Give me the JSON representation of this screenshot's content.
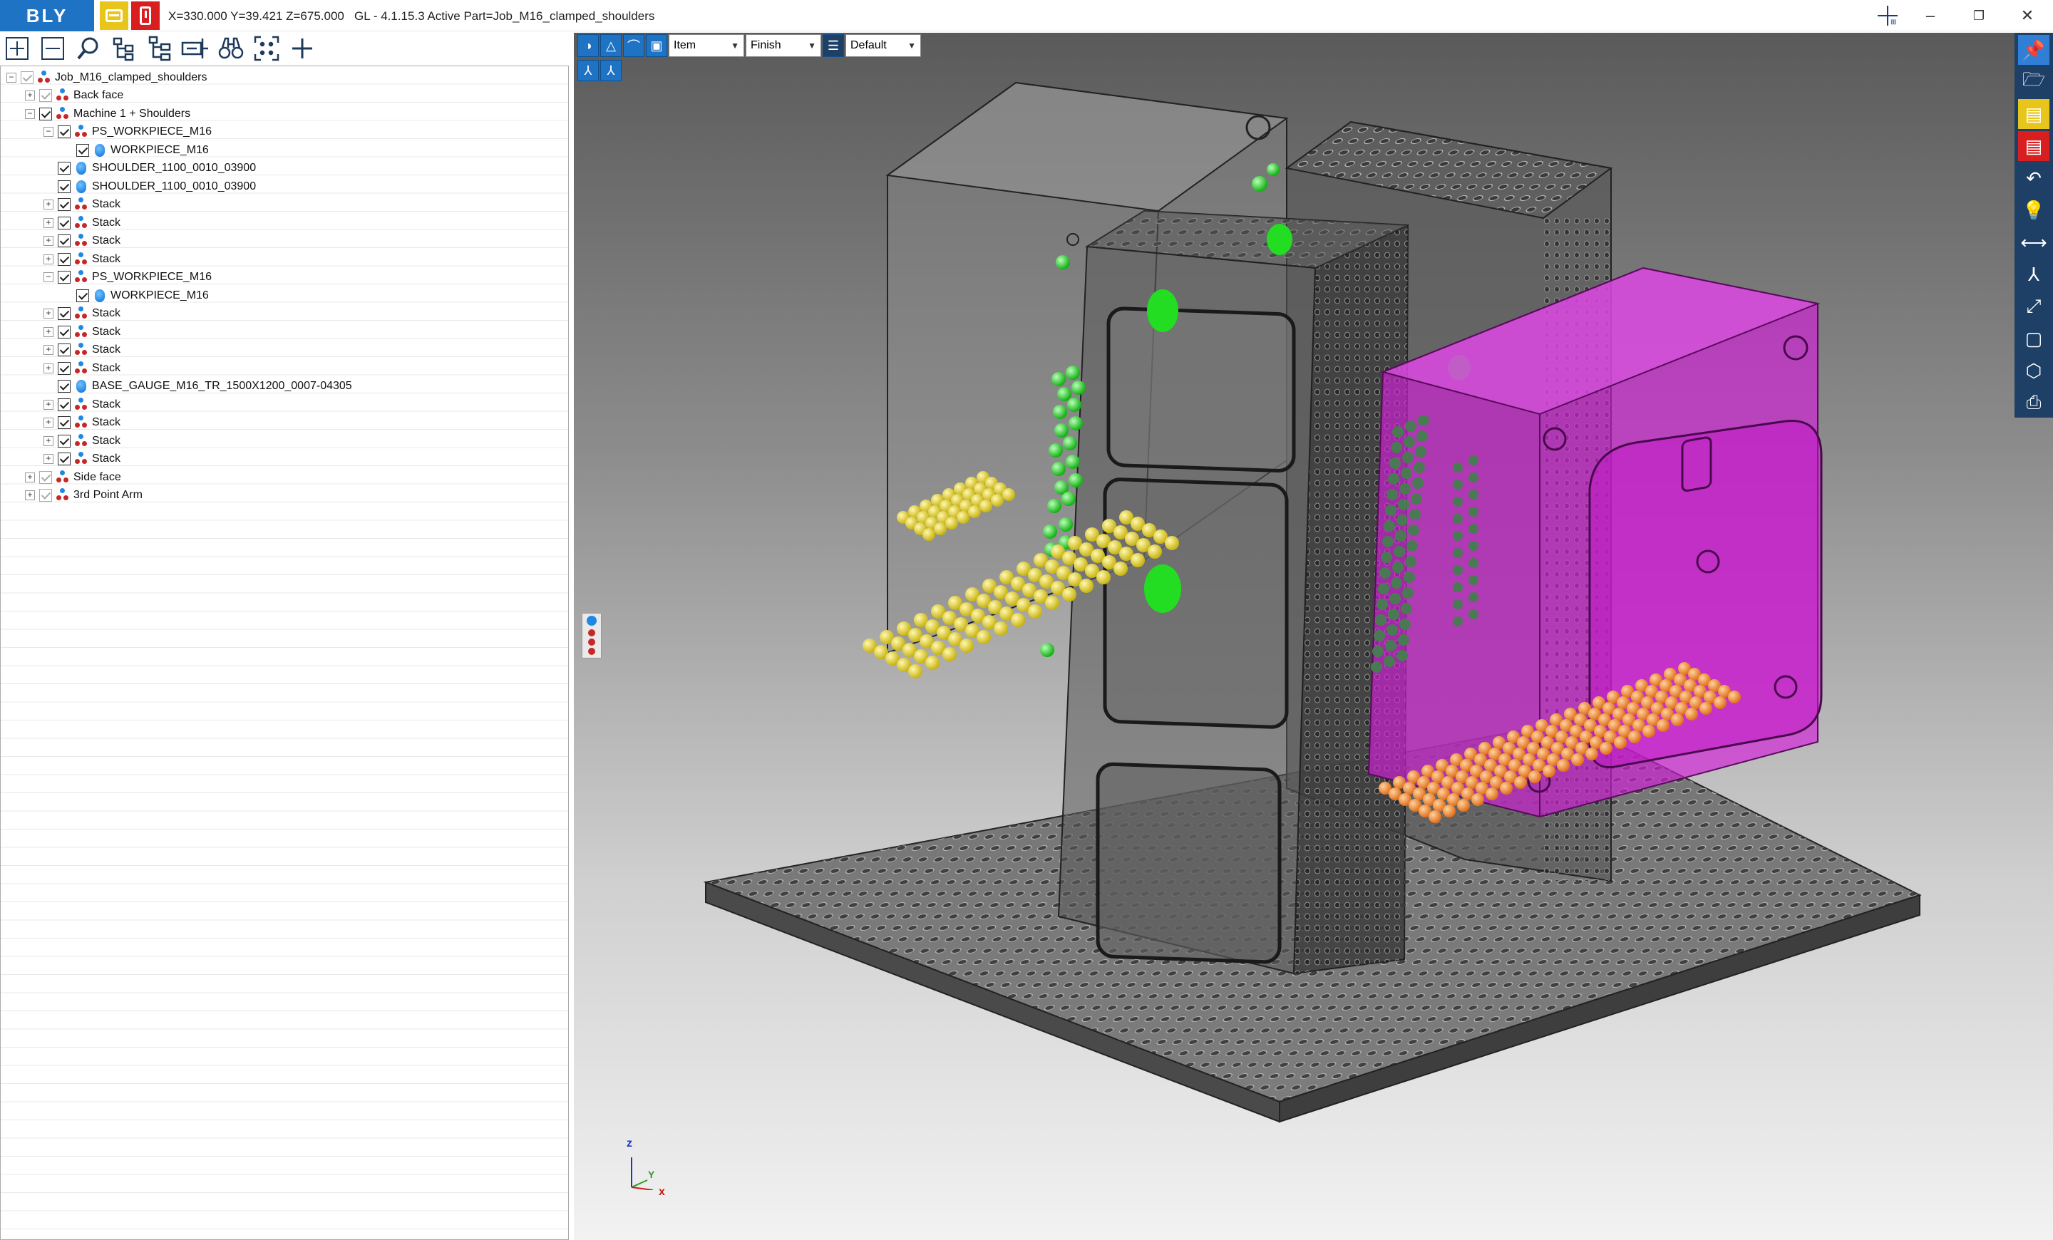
{
  "app": {
    "logo": "BLY",
    "status": "X=330.000 Y=39.421 Z=675.000   GL - 4.1.15.3 Active Part=Job_M16_clamped_shoulders"
  },
  "toolbar": {
    "icons": [
      "expand-all-icon",
      "collapse-all-icon",
      "search-icon",
      "tree-icon",
      "tree-branch-icon",
      "align-icon",
      "binoculars-icon",
      "fit-view-icon",
      "add-icon"
    ]
  },
  "tree": {
    "items": [
      {
        "label": "Job_M16_clamped_shoulders",
        "level": 0,
        "expander": "−",
        "icon": "assembly",
        "checked": true,
        "light": true
      },
      {
        "label": "Back face",
        "level": 1,
        "expander": "+",
        "icon": "assembly",
        "checked": true,
        "light": true
      },
      {
        "label": "Machine 1 + Shoulders",
        "level": 1,
        "expander": "−",
        "icon": "assembly",
        "checked": true,
        "light": false
      },
      {
        "label": "PS_WORKPIECE_M16",
        "level": 2,
        "expander": "−",
        "icon": "assembly",
        "checked": true,
        "light": false
      },
      {
        "label": "WORKPIECE_M16",
        "level": 3,
        "expander": "",
        "icon": "part",
        "checked": true,
        "light": false
      },
      {
        "label": "SHOULDER_1100_0010_03900",
        "level": 2,
        "expander": "",
        "icon": "part",
        "checked": true,
        "light": false
      },
      {
        "label": "SHOULDER_1100_0010_03900",
        "level": 2,
        "expander": "",
        "icon": "part",
        "checked": true,
        "light": false
      },
      {
        "label": "Stack",
        "level": 2,
        "expander": "+",
        "icon": "assembly",
        "checked": true,
        "light": false
      },
      {
        "label": "Stack",
        "level": 2,
        "expander": "+",
        "icon": "assembly",
        "checked": true,
        "light": false
      },
      {
        "label": "Stack",
        "level": 2,
        "expander": "+",
        "icon": "assembly",
        "checked": true,
        "light": false
      },
      {
        "label": "Stack",
        "level": 2,
        "expander": "+",
        "icon": "assembly",
        "checked": true,
        "light": false
      },
      {
        "label": "PS_WORKPIECE_M16",
        "level": 2,
        "expander": "−",
        "icon": "assembly",
        "checked": true,
        "light": false
      },
      {
        "label": "WORKPIECE_M16",
        "level": 3,
        "expander": "",
        "icon": "part",
        "checked": true,
        "light": false
      },
      {
        "label": "Stack",
        "level": 2,
        "expander": "+",
        "icon": "assembly",
        "checked": true,
        "light": false
      },
      {
        "label": "Stack",
        "level": 2,
        "expander": "+",
        "icon": "assembly",
        "checked": true,
        "light": false
      },
      {
        "label": "Stack",
        "level": 2,
        "expander": "+",
        "icon": "assembly",
        "checked": true,
        "light": false
      },
      {
        "label": "Stack",
        "level": 2,
        "expander": "+",
        "icon": "assembly",
        "checked": true,
        "light": false
      },
      {
        "label": "BASE_GAUGE_M16_TR_1500X1200_0007-04305",
        "level": 2,
        "expander": "",
        "icon": "part",
        "checked": true,
        "light": false
      },
      {
        "label": "Stack",
        "level": 2,
        "expander": "+",
        "icon": "assembly",
        "checked": true,
        "light": false
      },
      {
        "label": "Stack",
        "level": 2,
        "expander": "+",
        "icon": "assembly",
        "checked": true,
        "light": false
      },
      {
        "label": "Stack",
        "level": 2,
        "expander": "+",
        "icon": "assembly",
        "checked": true,
        "light": false
      },
      {
        "label": "Stack",
        "level": 2,
        "expander": "+",
        "icon": "assembly",
        "checked": true,
        "light": false
      },
      {
        "label": "Side face",
        "level": 1,
        "expander": "+",
        "icon": "assembly",
        "checked": true,
        "light": true
      },
      {
        "label": "3rd Point Arm",
        "level": 1,
        "expander": "+",
        "icon": "assembly",
        "checked": true,
        "light": true
      }
    ]
  },
  "viewport": {
    "combo1": "Item",
    "combo2": "Finish",
    "combo3": "Default",
    "axes": {
      "z": "z",
      "y": "Y",
      "x": "x"
    },
    "colors": {
      "workpiece": "#d020d8",
      "spheres_green": "#2fd02f",
      "spheres_yellow": "#e2d21a",
      "spheres_orange": "#f08a2a",
      "fixture": "#555555"
    }
  },
  "sidepanel": {
    "icons": [
      "pin-icon",
      "open-folder-icon",
      "yellow-panel-icon",
      "red-panel-icon",
      "undo-icon",
      "lightbulb-icon",
      "measure-icon",
      "axes-icon",
      "expand-icon",
      "panel-icon",
      "cube-icon",
      "print-icon"
    ]
  }
}
